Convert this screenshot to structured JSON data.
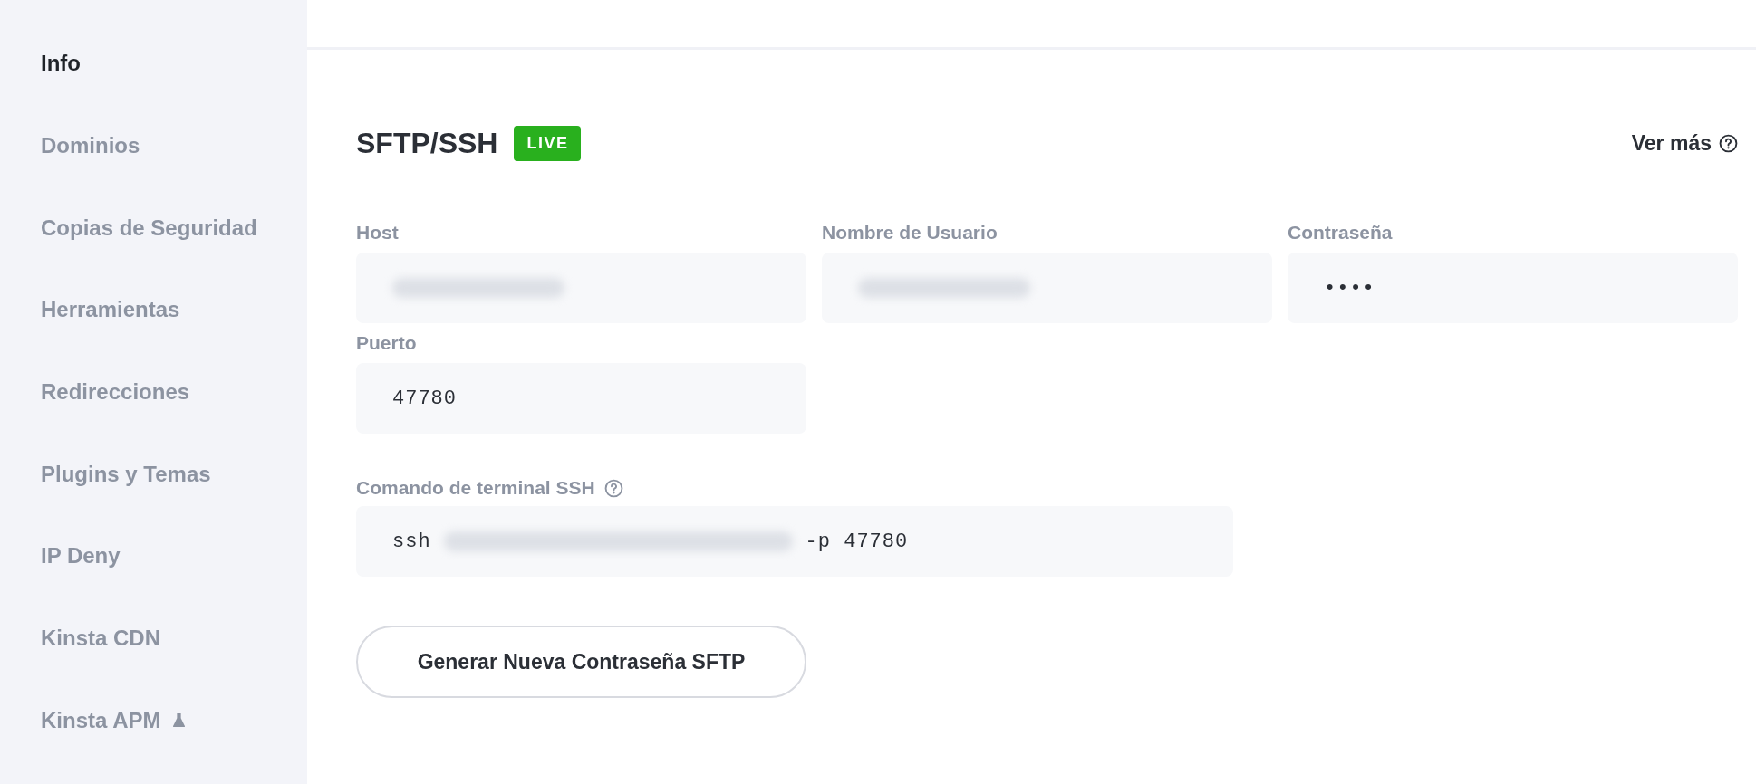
{
  "sidebar": {
    "items": [
      {
        "label": "Info",
        "selected": true,
        "kind": "plain"
      },
      {
        "label": "Dominios",
        "selected": false,
        "kind": "plain"
      },
      {
        "label": "Copias de Seguridad",
        "selected": false,
        "kind": "plain"
      },
      {
        "label": "Herramientas",
        "selected": false,
        "kind": "plain"
      },
      {
        "label": "Redirecciones",
        "selected": false,
        "kind": "plain"
      },
      {
        "label": "Plugins y Temas",
        "selected": false,
        "kind": "plain"
      },
      {
        "label": "IP Deny",
        "selected": false,
        "kind": "plain"
      },
      {
        "label": "Kinsta CDN",
        "selected": false,
        "kind": "plain"
      },
      {
        "label": "Kinsta APM",
        "selected": false,
        "kind": "beta"
      }
    ]
  },
  "section": {
    "title": "SFTP/SSH",
    "badge": "LIVE",
    "link": "Ver más"
  },
  "fields": [
    {
      "label": "Host",
      "blurred": true
    },
    {
      "label": "Nombre de Usuario",
      "blurred": true
    },
    {
      "label": "Contraseña",
      "value": "••••",
      "blurred": false
    },
    {
      "label": "Puerto",
      "value": "47780",
      "blurred": false
    }
  ],
  "command": {
    "label": "Comando de terminal SSH",
    "prefix": "ssh",
    "blurred": true,
    "suffix": "-p 47780"
  },
  "button": "Generar Nueva Contraseña SFTP"
}
